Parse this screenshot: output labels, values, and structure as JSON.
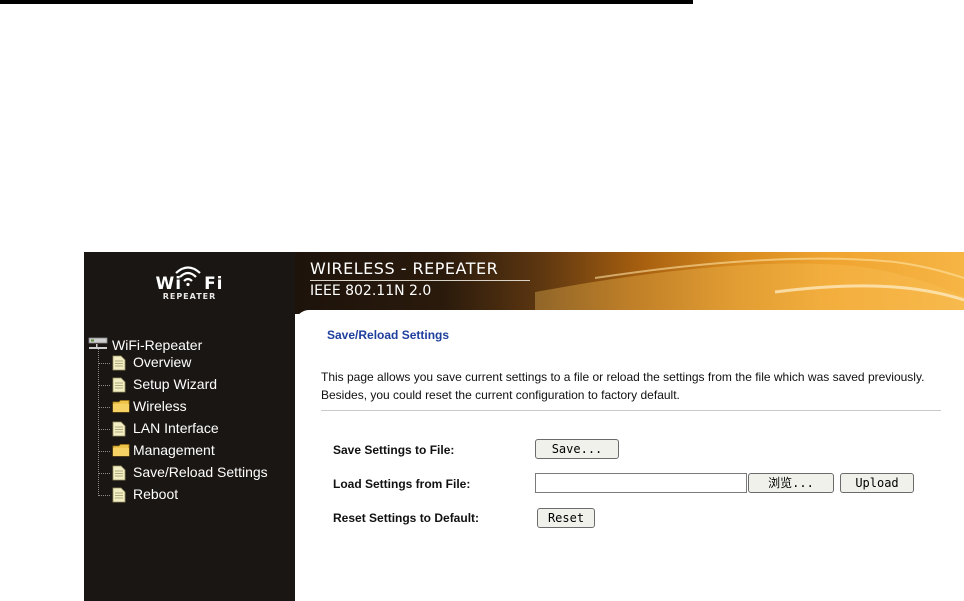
{
  "logo": {
    "brand_left": "Wi",
    "brand_right": "Fi",
    "subtitle": "REPEATER"
  },
  "banner": {
    "line1": "WIRELESS - REPEATER",
    "line2": "IEEE 802.11N 2.0"
  },
  "nav": {
    "root": "WiFi-Repeater",
    "items": [
      {
        "label": "Overview",
        "icon": "page-icon"
      },
      {
        "label": "Setup Wizard",
        "icon": "page-icon"
      },
      {
        "label": "Wireless",
        "icon": "folder-icon"
      },
      {
        "label": "LAN Interface",
        "icon": "page-icon"
      },
      {
        "label": "Management",
        "icon": "folder-icon"
      },
      {
        "label": "Save/Reload Settings",
        "icon": "page-icon"
      },
      {
        "label": "Reboot",
        "icon": "page-icon"
      }
    ]
  },
  "main": {
    "title": "Save/Reload Settings",
    "description": "This page allows you save current settings to a file or reload the settings from the file which was saved previously. Besides, you could reset the current configuration to factory default.",
    "save_label": "Save Settings to File:",
    "save_button": "Save...",
    "load_label": "Load Settings from File:",
    "file_value": "",
    "browse_button": "浏览...",
    "upload_button": "Upload",
    "reset_label": "Reset Settings to Default:",
    "reset_button": "Reset"
  },
  "colors": {
    "sidebar_bg": "#1a1613",
    "title_blue": "#1f3f9c",
    "banner_orange": "#f0a430"
  }
}
